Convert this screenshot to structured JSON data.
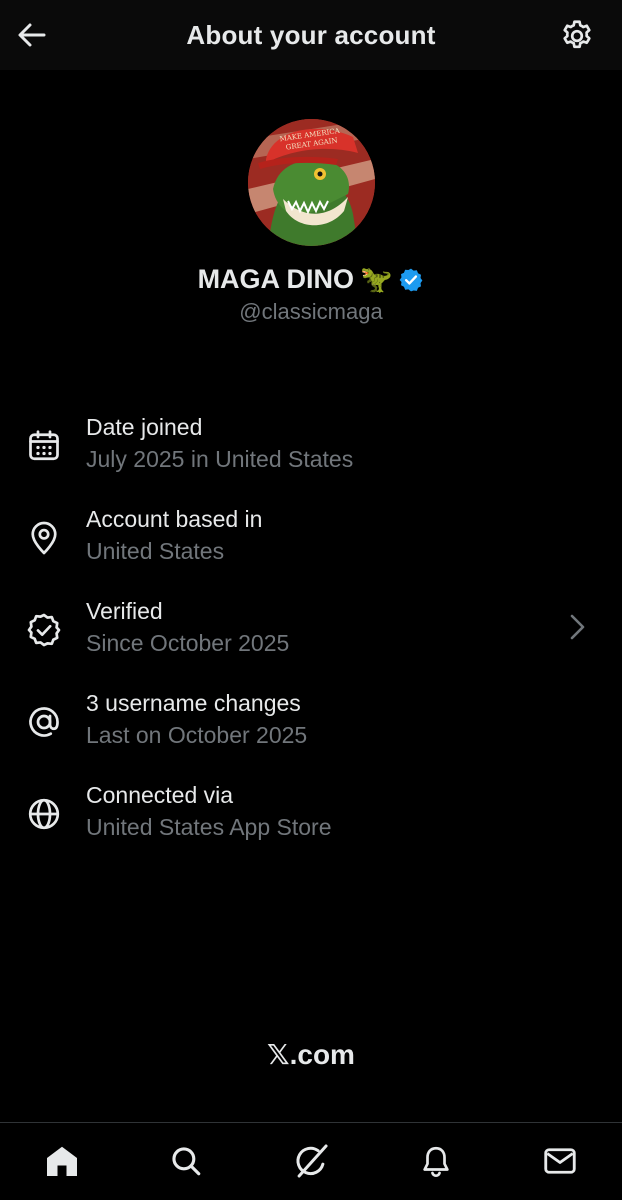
{
  "header": {
    "title": "About your account",
    "back_icon": "arrow-left-icon",
    "settings_icon": "gear-icon"
  },
  "profile": {
    "avatar_icon": "dinosaur-avatar",
    "display_name": "MAGA DINO",
    "name_emoji": "🦖",
    "verified_icon": "verified-badge-icon",
    "handle": "@classicmaga",
    "verified_color": "#1d9bf0"
  },
  "info": {
    "items": [
      {
        "icon": "calendar-icon",
        "title": "Date joined",
        "subtitle": "July 2025 in United States"
      },
      {
        "icon": "location-pin-icon",
        "title": "Account based in",
        "subtitle": "United States"
      },
      {
        "icon": "verified-outline-icon",
        "title": "Verified",
        "subtitle": "Since October 2025",
        "has_chevron": true
      },
      {
        "icon": "at-sign-icon",
        "title": "3 username changes",
        "subtitle": "Last on October 2025"
      },
      {
        "icon": "globe-icon",
        "title": "Connected via",
        "subtitle": "United States App Store"
      }
    ]
  },
  "footer": {
    "brand_mark": "𝕏",
    "brand_suffix": ".com"
  },
  "tabbar": {
    "tabs": [
      {
        "icon": "home-icon"
      },
      {
        "icon": "search-icon"
      },
      {
        "icon": "grok-icon"
      },
      {
        "icon": "bell-icon"
      },
      {
        "icon": "mail-icon"
      }
    ]
  },
  "colors": {
    "background": "#000000",
    "text_primary": "#e7e9ea",
    "text_secondary": "#71767b",
    "accent": "#1d9bf0"
  }
}
